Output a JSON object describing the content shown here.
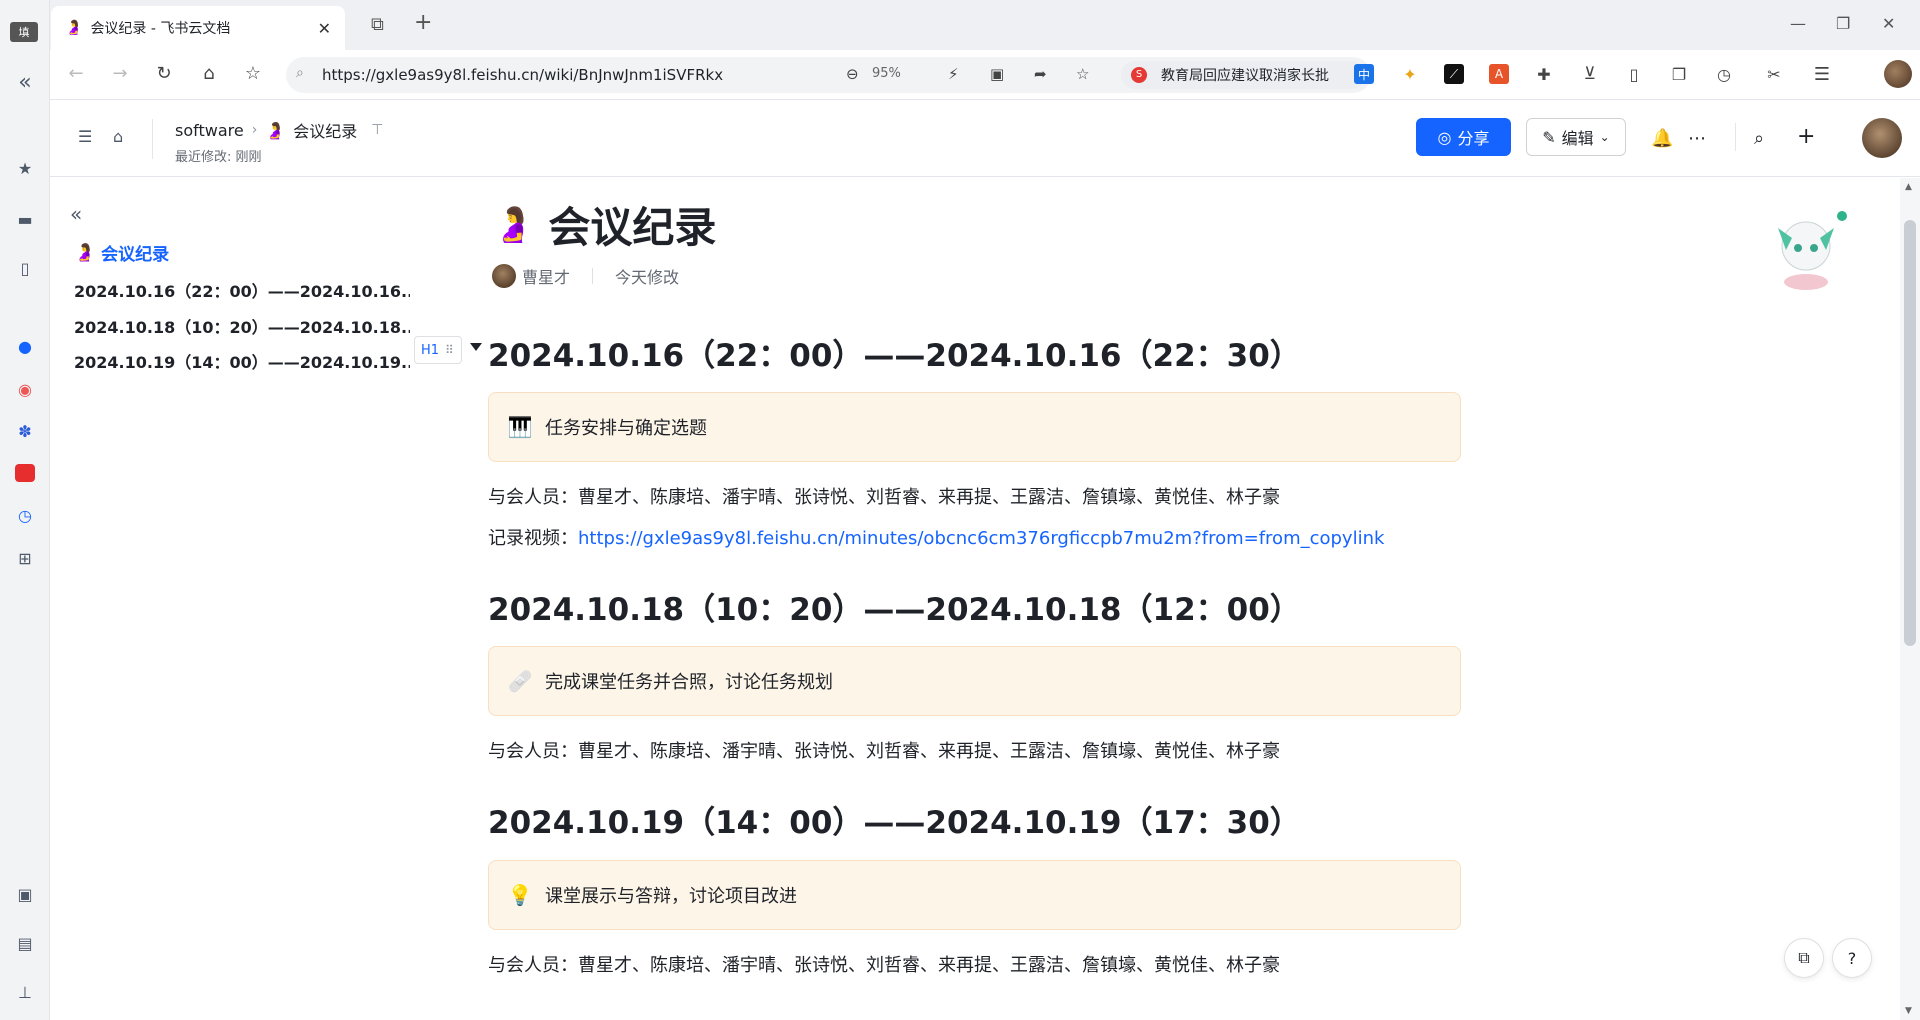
{
  "browser": {
    "tab_title": "会议纪录 - 飞书云文档",
    "tab_favicon": "🤰",
    "url": "https://gxle9as9y8l.feishu.cn/wiki/BnJnwJnm1iSVFRkx",
    "zoom": "95%",
    "news_text": "教育局回应建议取消家长批",
    "rail_tag": "填"
  },
  "doc_header": {
    "breadcrumb_root": "software",
    "breadcrumb_current": "会议纪录",
    "page_emoji": "🤰",
    "last_modified": "最近修改: 刚刚",
    "share_label": "分享",
    "edit_label": "编辑"
  },
  "toc": {
    "root_label": "会议纪录",
    "items": [
      "2024.10.16（22：00）——2024.10.16...",
      "2024.10.18（10：20）——2024.10.18...",
      "2024.10.19（14：00）——2024.10.19..."
    ],
    "h1_tag": "H1"
  },
  "doc": {
    "title": "会议纪录",
    "author": "曹星才",
    "modified": "今天修改",
    "sections": [
      {
        "heading": "2024.10.16（22：00）——2024.10.16（22：30）",
        "callout_icon": "🎹",
        "callout_text": "任务安排与确定选题",
        "attendees": "与会人员：曹星才、陈康培、潘宇晴、张诗悦、刘哲睿、来再提、王露洁、詹镇壕、黄悦佳、林子豪",
        "video_label": "记录视频：",
        "video_link": "https://gxle9as9y8l.feishu.cn/minutes/obcnc6cm376rgficcpb7mu2m?from=from_copylink"
      },
      {
        "heading": "2024.10.18（10：20）——2024.10.18（12：00）",
        "callout_icon": "🩹",
        "callout_text": "完成课堂任务并合照，讨论任务规划",
        "attendees": "与会人员：曹星才、陈康培、潘宇晴、张诗悦、刘哲睿、来再提、王露洁、詹镇壕、黄悦佳、林子豪"
      },
      {
        "heading": "2024.10.19（14：00）——2024.10.19（17：30）",
        "callout_icon": "💡",
        "callout_text": "课堂展示与答辩，讨论项目改进",
        "attendees": "与会人员：曹星才、陈康培、潘宇晴、张诗悦、刘哲睿、来再提、王露洁、詹镇壕、黄悦佳、林子豪"
      }
    ]
  },
  "colors": {
    "accent": "#1664ff",
    "callout_bg": "#fef5e9",
    "callout_border": "#f8dfc1",
    "text": "#1f2329"
  }
}
